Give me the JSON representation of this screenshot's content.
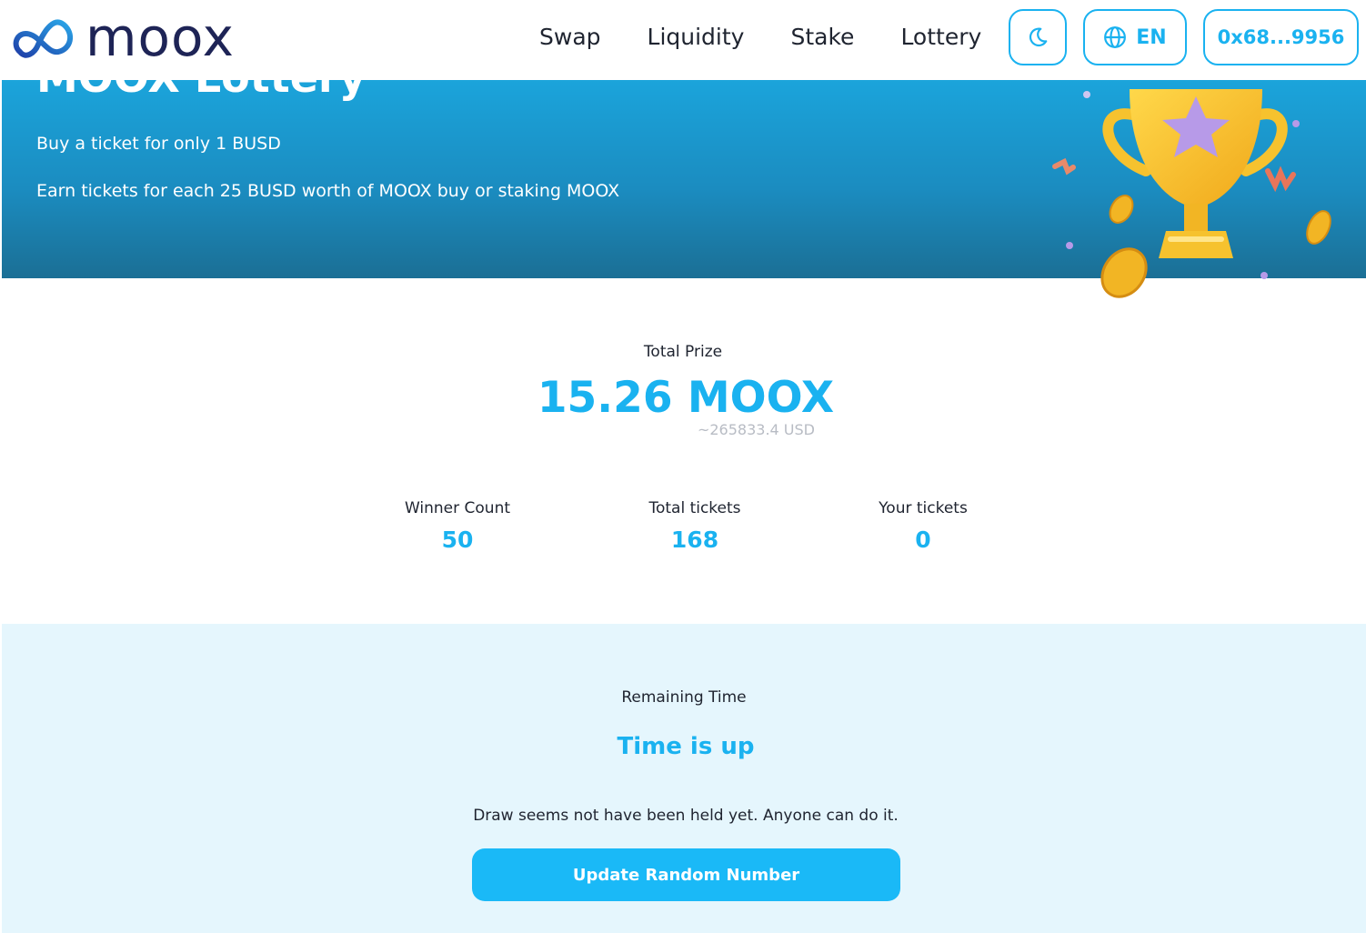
{
  "brand": {
    "name": "moox"
  },
  "nav": {
    "items": [
      {
        "label": "Swap"
      },
      {
        "label": "Liquidity"
      },
      {
        "label": "Stake"
      },
      {
        "label": "Lottery"
      }
    ]
  },
  "header": {
    "theme_icon": "moon-icon",
    "language": {
      "icon": "globe-icon",
      "label": "EN"
    },
    "wallet": {
      "label": "0x68...9956"
    }
  },
  "hero": {
    "title": "MOOX Lottery",
    "line1": "Buy a ticket for only 1 BUSD",
    "line2": "Earn tickets for each 25 BUSD worth of MOOX buy or staking MOOX",
    "image": "trophy-illustration"
  },
  "prize": {
    "label": "Total Prize",
    "value": "15.26 MOOX",
    "usd": "~265833.4 USD"
  },
  "stats": [
    {
      "label": "Winner Count",
      "value": "50"
    },
    {
      "label": "Total tickets",
      "value": "168"
    },
    {
      "label": "Your tickets",
      "value": "0"
    }
  ],
  "draw": {
    "label": "Remaining Time",
    "status": "Time is up",
    "note": "Draw seems not have been held yet. Anyone can do it.",
    "button_label": "Update Random Number"
  },
  "colors": {
    "accent": "#1ab2f0",
    "brand_dark": "#1e2456",
    "hero_top": "#1ba4db",
    "hero_bottom": "#1b6f95",
    "draw_bg": "#e5f6fd"
  }
}
